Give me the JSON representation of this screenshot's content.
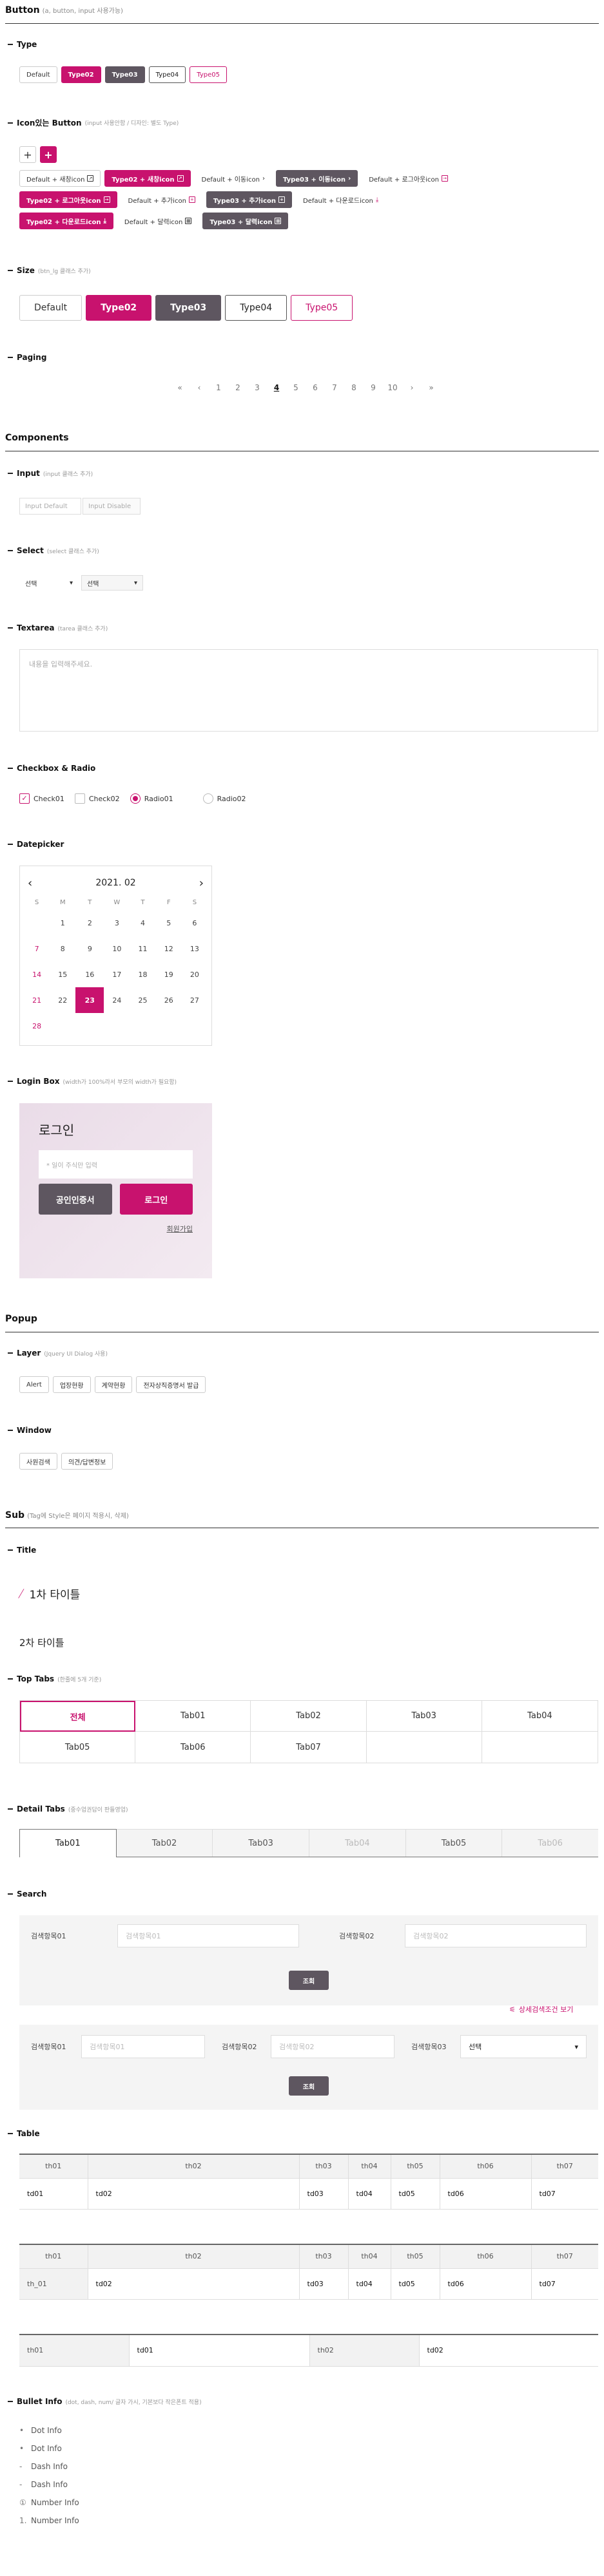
{
  "button": {
    "title": "Button",
    "note": "(a, button, input 사용가능)"
  },
  "type": {
    "title": "Type",
    "items": [
      "Default",
      "Type02",
      "Type03",
      "Type04",
      "Type05"
    ]
  },
  "iconbtn": {
    "title": "Icon있는 Button",
    "note": "(input 사용안함 / 디자인: 별도 Type)",
    "plus": "+",
    "row1": [
      "Default + 새창icon",
      "Type02 + 새창icon",
      "Default + 이동icon",
      "Type03 + 이동icon",
      "Default + 로그아웃icon"
    ],
    "row2": [
      "Type02 + 로그아웃icon",
      "Default + 추가icon",
      "Type03 + 추가icon",
      "Default + 다운로드icon"
    ],
    "row3": [
      "Type02 + 다운로드icon",
      "Default + 달력icon",
      "Type03 + 달력icon"
    ]
  },
  "size": {
    "title": "Size",
    "note": "(btn_lg 클래스 추가)",
    "items": [
      "Default",
      "Type02",
      "Type03",
      "Type04",
      "Type05"
    ]
  },
  "paging": {
    "title": "Paging",
    "items": [
      "«",
      "‹",
      "1",
      "2",
      "3",
      "4",
      "5",
      "6",
      "7",
      "8",
      "9",
      "10",
      "›",
      "»"
    ],
    "current": "4"
  },
  "components": {
    "title": "Components"
  },
  "input": {
    "title": "Input",
    "note": "(input 클래스 추가)",
    "default": "Input Default",
    "disable": "Input Disable"
  },
  "select": {
    "title": "Select",
    "note": "(select 클래스 추가)",
    "v1": "선택",
    "v2": "선택"
  },
  "textarea": {
    "title": "Textarea",
    "note": "(tarea 클래스 추가)",
    "placeholder": "내용을 입력해주세요."
  },
  "chk": {
    "title": "Checkbox & Radio",
    "items": [
      "Check01",
      "Check02",
      "Radio01",
      "Radio02"
    ]
  },
  "datepicker": {
    "title": "Datepicker",
    "month": "2021. 02",
    "days": [
      "S",
      "M",
      "T",
      "W",
      "T",
      "F",
      "S"
    ],
    "weeks": [
      [
        "",
        "1",
        "2",
        "3",
        "4",
        "5",
        "6"
      ],
      [
        "7",
        "8",
        "9",
        "10",
        "11",
        "12",
        "13"
      ],
      [
        "14",
        "15",
        "16",
        "17",
        "18",
        "19",
        "20"
      ],
      [
        "21",
        "22",
        "23",
        "24",
        "25",
        "26",
        "27"
      ],
      [
        "28",
        "",
        "",
        "",
        "",
        "",
        ""
      ]
    ],
    "selected": "23"
  },
  "login": {
    "title": "Login Box",
    "note": "(width가 100%라서 부모의 width가 필요함)",
    "heading": "로그인",
    "placeholder": "* 일이 주식만 입력",
    "cert": "공인인증서",
    "login": "로그인",
    "join": "회원가입"
  },
  "popup": {
    "title": "Popup"
  },
  "layer": {
    "title": "Layer",
    "note": "(Jquery UI Dialog 사용)",
    "items": [
      "Alert",
      "업장현황",
      "계약현황",
      "전자상직증명서 발급"
    ]
  },
  "window": {
    "title": "Window",
    "items": [
      "사원검색",
      "의견/답변정보"
    ]
  },
  "sub": {
    "title": "Sub",
    "note": "(Tag에 Style은 페이지 적용시, 삭제)"
  },
  "titles": {
    "title": "Title",
    "t1": "1차 타이틀",
    "t2": "2차 타이틀"
  },
  "toptabs": {
    "title": "Top Tabs",
    "note": "(한줄에 5개 기준)",
    "items": [
      "전체",
      "Tab01",
      "Tab02",
      "Tab03",
      "Tab04",
      "Tab05",
      "Tab06",
      "Tab07"
    ]
  },
  "detailtabs": {
    "title": "Detail Tabs",
    "note": "(중수업권답이 판들영업)",
    "items": [
      "Tab01",
      "Tab02",
      "Tab03",
      "Tab04",
      "Tab05",
      "Tab06"
    ]
  },
  "search": {
    "title": "Search",
    "l1": "검색항목01",
    "l2": "검색항목02",
    "p1": "검색항목01",
    "p2": "검색항목02",
    "btn": "조회",
    "detail": "상세검색조건 보기",
    "l3": "검색항목03",
    "sel": "선택"
  },
  "table": {
    "title": "Table",
    "h1": [
      "th01",
      "th02",
      "th03",
      "th04",
      "th05",
      "th06",
      "th07"
    ],
    "r1": [
      "td01",
      "td02",
      "td03",
      "td04",
      "td05",
      "td06",
      "td07"
    ],
    "h2": [
      "th01",
      "th02",
      "th03",
      "th04",
      "th05",
      "th06",
      "th07"
    ],
    "r2": [
      "th_01",
      "td02",
      "td03",
      "td04",
      "td05",
      "td06",
      "td07"
    ],
    "r3": [
      "th01",
      "td01",
      "th02",
      "td02"
    ]
  },
  "bullet": {
    "title": "Bullet Info",
    "note": "(dot, dash, num/ 글자 가시, 기본보다 작은폰트 적용)",
    "items": [
      "Dot Info",
      "Dot Info",
      "Dash Info",
      "Dash Info",
      "Number Info",
      "Number Info"
    ],
    "marks": [
      "•",
      "•",
      "-",
      "-",
      "①",
      "1."
    ]
  },
  "colors": {
    "accent": "#c8126e",
    "dark": "#5e5660"
  }
}
